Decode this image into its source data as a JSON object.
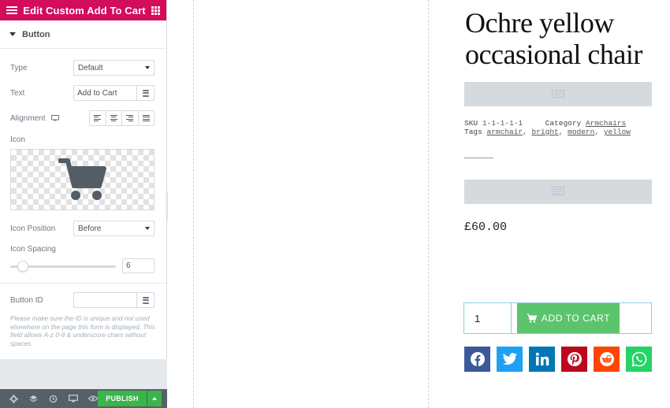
{
  "panel": {
    "header_title": "Edit Custom Add To Cart",
    "section_label": "Button",
    "fields": {
      "type_label": "Type",
      "type_value": "Default",
      "text_label": "Text",
      "text_value": "Add to Cart",
      "alignment_label": "Alignment",
      "icon_label": "Icon",
      "icon_position_label": "Icon Position",
      "icon_position_value": "Before",
      "icon_spacing_label": "Icon Spacing",
      "icon_spacing_value": "6",
      "button_id_label": "Button ID",
      "button_id_value": ""
    },
    "note_text": "Please make sure the ID is unique and not used elsewhere on the page this form is displayed. This field allows A-z 0-9 & underscore chars without spaces.",
    "publish_label": "PUBLISH",
    "colors": {
      "header": "#d30c5c",
      "publish": "#39b54a",
      "footer": "#556068"
    }
  },
  "product": {
    "title": "Ochre yellow occasional chair",
    "sku_label": "SKU",
    "sku_value": "1-1-1-1-1",
    "category_label": "Category",
    "category_value": "Armchairs",
    "tags_label": "Tags",
    "tags": [
      "armchair",
      "bright",
      "modern",
      "yellow"
    ],
    "price": "£60.00",
    "quantity": "1",
    "add_to_cart_label": "ADD TO CART",
    "share_icons": [
      {
        "name": "facebook-icon",
        "color": "#3b5998"
      },
      {
        "name": "twitter-icon",
        "color": "#1da1f2"
      },
      {
        "name": "linkedin-icon",
        "color": "#0077b5"
      },
      {
        "name": "pinterest-icon",
        "color": "#bd081c"
      },
      {
        "name": "reddit-icon",
        "color": "#ff4500"
      },
      {
        "name": "whatsapp-icon",
        "color": "#25d366"
      }
    ]
  }
}
